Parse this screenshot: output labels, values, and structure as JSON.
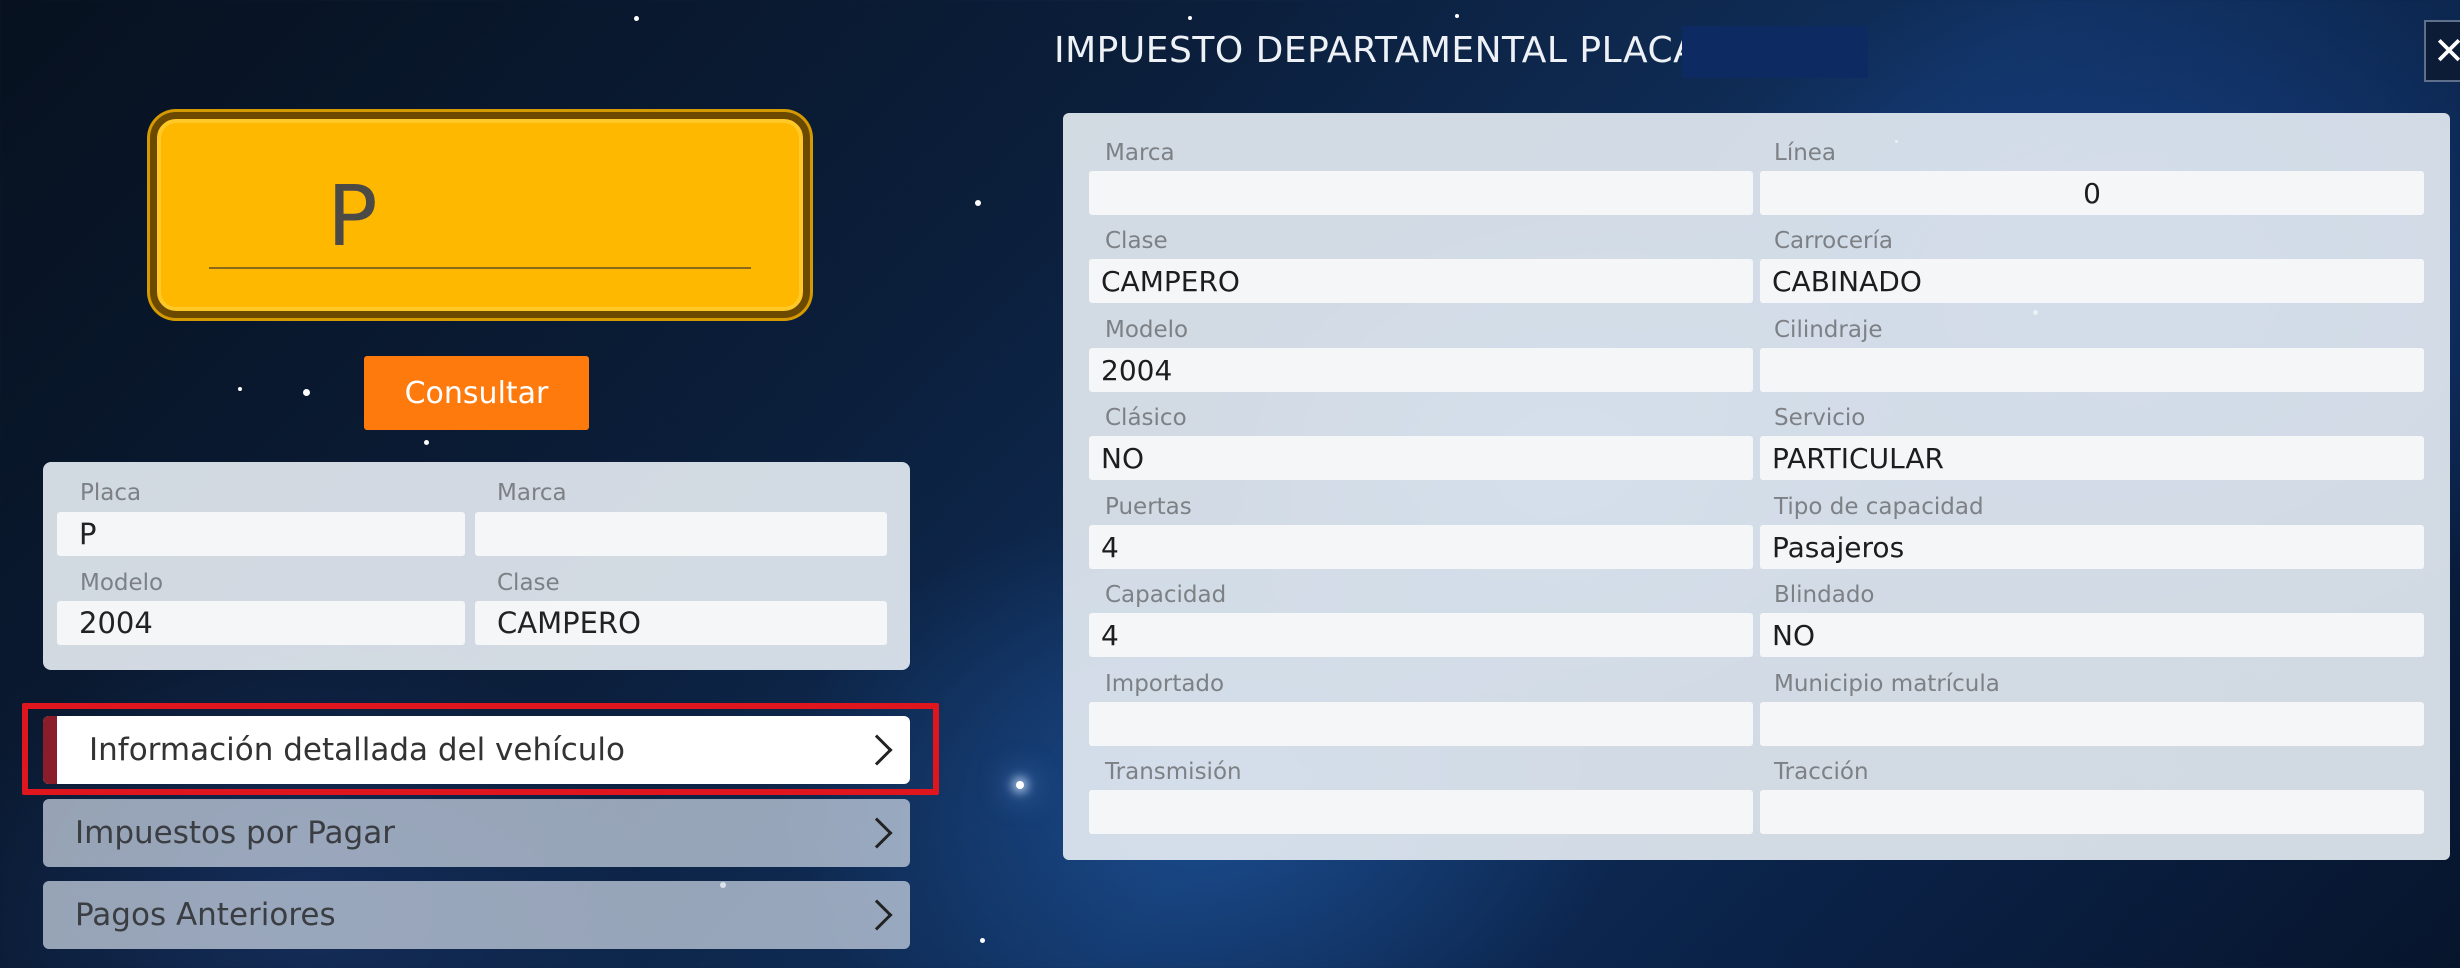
{
  "plate": {
    "text": "P"
  },
  "consultar_label": "Consultar",
  "summary": {
    "placa_label": "Placa",
    "placa_value": "P",
    "marca_label": "Marca",
    "marca_value": "",
    "modelo_label": "Modelo",
    "modelo_value": "2004",
    "clase_label": "Clase",
    "clase_value": "CAMPERO"
  },
  "menu": {
    "info": "Información detallada del vehículo",
    "impuestos": "Impuestos por Pagar",
    "pagos": "Pagos Anteriores"
  },
  "detail": {
    "title": "IMPUESTO DEPARTAMENTAL PLACA",
    "close": "✕",
    "marca_label": "Marca",
    "marca_value": "",
    "linea_label": "Línea",
    "linea_value": "0",
    "clase_label": "Clase",
    "clase_value": "CAMPERO",
    "carroceria_label": "Carrocería",
    "carroceria_value": "CABINADO",
    "modelo_label": "Modelo",
    "modelo_value": "2004",
    "cilindraje_label": "Cilindraje",
    "cilindraje_value": "",
    "clasico_label": "Clásico",
    "clasico_value": "NO",
    "servicio_label": "Servicio",
    "servicio_value": "PARTICULAR",
    "puertas_label": "Puertas",
    "puertas_value": "4",
    "tipo_capacidad_label": "Tipo de capacidad",
    "tipo_capacidad_value": "Pasajeros",
    "capacidad_label": "Capacidad",
    "capacidad_value": "4",
    "blindado_label": "Blindado",
    "blindado_value": "NO",
    "importado_label": "Importado",
    "importado_value": "",
    "municipio_label": "Municipio matrícula",
    "municipio_value": "",
    "transmision_label": "Transmisión",
    "transmision_value": "",
    "traccion_label": "Tracción",
    "traccion_value": ""
  }
}
